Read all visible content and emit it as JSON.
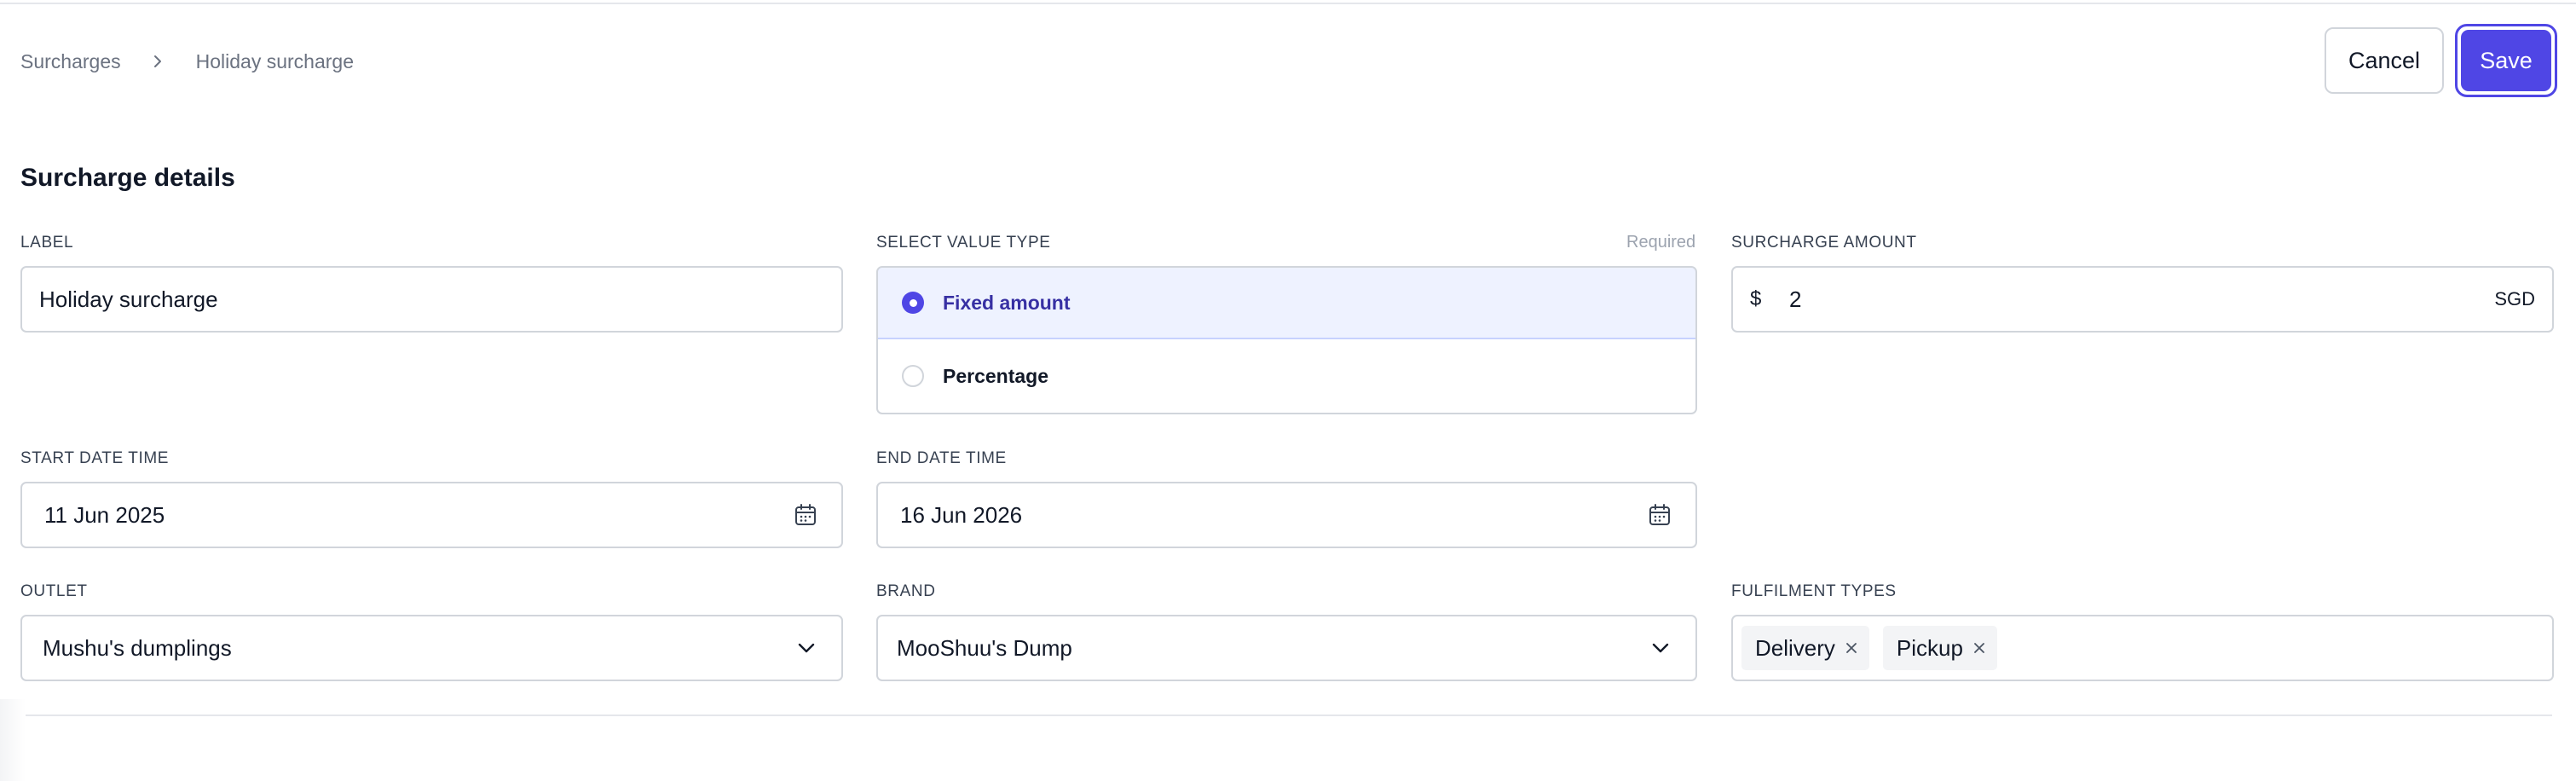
{
  "breadcrumb": {
    "parent": "Surcharges",
    "current": "Holiday surcharge"
  },
  "header": {
    "cancel_label": "Cancel",
    "save_label": "Save"
  },
  "section": {
    "title": "Surcharge details"
  },
  "fields": {
    "label": {
      "label": "LABEL",
      "value": "Holiday surcharge"
    },
    "value_type": {
      "label": "SELECT VALUE TYPE",
      "required_text": "Required",
      "options": [
        {
          "label": "Fixed amount",
          "selected": true
        },
        {
          "label": "Percentage",
          "selected": false
        }
      ]
    },
    "surcharge_amount": {
      "label": "SURCHARGE AMOUNT",
      "prefix": "$",
      "value": "2",
      "suffix": "SGD"
    },
    "start_date": {
      "label": "START DATE TIME",
      "value": "11 Jun 2025",
      "icon": "calendar-icon"
    },
    "end_date": {
      "label": "END DATE TIME",
      "value": "16 Jun 2026",
      "icon": "calendar-icon"
    },
    "outlet": {
      "label": "OUTLET",
      "value": "Mushu's dumplings",
      "icon": "chevron-down-icon"
    },
    "brand": {
      "label": "BRAND",
      "value": "MooShuu's Dump",
      "icon": "chevron-down-icon"
    },
    "fulfilment_types": {
      "label": "FULFILMENT TYPES",
      "tags": [
        "Delivery",
        "Pickup"
      ]
    }
  },
  "colors": {
    "accent": "#4f46e5",
    "selected_bg": "#eef2ff",
    "border": "#d1d5db"
  }
}
